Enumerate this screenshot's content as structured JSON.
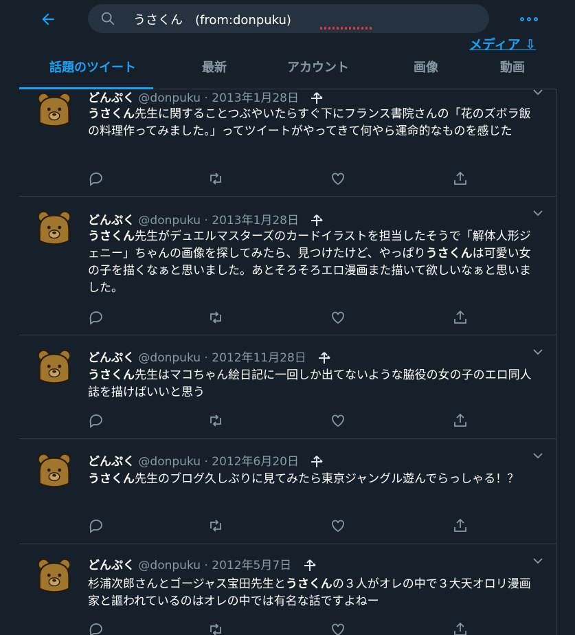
{
  "search": {
    "query": "うさくん　(from:donpuku)",
    "squiggle_word": "donpuku"
  },
  "header": {
    "media_link": "メディア ⇩"
  },
  "tabs": [
    {
      "label": "話題のツイート",
      "active": true
    },
    {
      "label": "最新",
      "active": false
    },
    {
      "label": "アカウント",
      "active": false
    },
    {
      "label": "画像",
      "active": false
    },
    {
      "label": "動画",
      "active": false
    }
  ],
  "tweets": [
    {
      "name": "どんぷく",
      "handle": "@donpuku",
      "dot": "·",
      "date": "2013年1月28日",
      "body": [
        {
          "text": "うさくん",
          "bold": true
        },
        {
          "text": "先生に関することつぶやいたらすぐ下にフランス書院さんの「花のズボラ飯の料理作ってみました。」ってツイートがやってきて何やら運命的なものを感じた",
          "bold": false
        }
      ]
    },
    {
      "name": "どんぷく",
      "handle": "@donpuku",
      "dot": "·",
      "date": "2013年1月28日",
      "body": [
        {
          "text": "うさくん",
          "bold": true
        },
        {
          "text": "先生がデュエルマスターズのカードイラストを担当したそうで「解体人形ジェニー」ちゃんの画像を探してみたら、見つけたけど、やっぱり",
          "bold": false
        },
        {
          "text": "うさくん",
          "bold": true
        },
        {
          "text": "は可愛い女の子を描くなぁと思いました。あとそろそろエロ漫画また描いて欲しいなぁと思いました。",
          "bold": false
        }
      ]
    },
    {
      "name": "どんぷく",
      "handle": "@donpuku",
      "dot": "·",
      "date": "2012年11月28日",
      "body": [
        {
          "text": "うさくん",
          "bold": true
        },
        {
          "text": "先生はマコちゃん絵日記に一回しか出てないような脇役の女の子のエロ同人誌を描けばいいと思う",
          "bold": false
        }
      ]
    },
    {
      "name": "どんぷく",
      "handle": "@donpuku",
      "dot": "·",
      "date": "2012年6月20日",
      "body": [
        {
          "text": "うさくん",
          "bold": true
        },
        {
          "text": "先生のブログ久しぶりに見てみたら東京ジャングル遊んでらっしゃる！？",
          "bold": false
        }
      ]
    },
    {
      "name": "どんぷく",
      "handle": "@donpuku",
      "dot": "·",
      "date": "2012年5月7日",
      "body": [
        {
          "text": "杉浦次郎さんとゴージャス宝田先生と",
          "bold": false
        },
        {
          "text": "うさくん",
          "bold": true
        },
        {
          "text": "の３人がオレの中で３大天オロリ漫画家と謳われているのはオレの中では有名な話ですよねー",
          "bold": false
        }
      ]
    }
  ],
  "colors": {
    "background": "#15202b",
    "accent": "#1da1f2",
    "muted": "#8899a6",
    "border": "#38444d",
    "search_bg": "#253341"
  },
  "icons": {
    "back": "arrow-left-icon",
    "search": "search-icon",
    "more": "more-dots-icon",
    "reply": "reply-icon",
    "retweet": "retweet-icon",
    "like": "heart-icon",
    "share": "share-icon",
    "caret": "chevron-down-icon",
    "compare": "swap-arrows-icon"
  }
}
